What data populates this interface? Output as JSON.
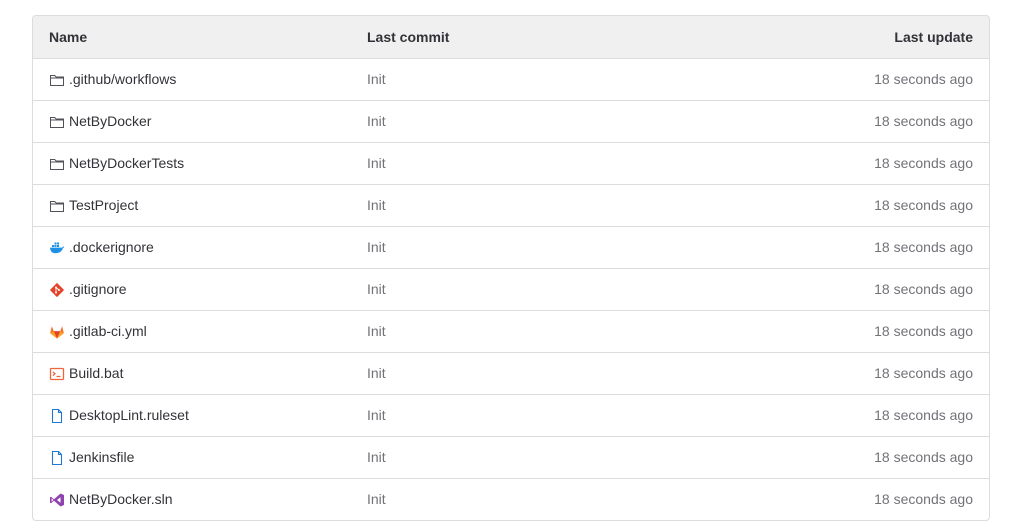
{
  "table": {
    "headers": {
      "name": "Name",
      "commit": "Last commit",
      "update": "Last update"
    },
    "rows": [
      {
        "name": ".github/workflows",
        "commit": "Init",
        "update": "18 seconds ago",
        "icon": "folder-icon"
      },
      {
        "name": "NetByDocker",
        "commit": "Init",
        "update": "18 seconds ago",
        "icon": "folder-icon"
      },
      {
        "name": "NetByDockerTests",
        "commit": "Init",
        "update": "18 seconds ago",
        "icon": "folder-icon"
      },
      {
        "name": "TestProject",
        "commit": "Init",
        "update": "18 seconds ago",
        "icon": "folder-icon"
      },
      {
        "name": ".dockerignore",
        "commit": "Init",
        "update": "18 seconds ago",
        "icon": "docker-icon"
      },
      {
        "name": ".gitignore",
        "commit": "Init",
        "update": "18 seconds ago",
        "icon": "git-icon"
      },
      {
        "name": ".gitlab-ci.yml",
        "commit": "Init",
        "update": "18 seconds ago",
        "icon": "gitlab-icon"
      },
      {
        "name": "Build.bat",
        "commit": "Init",
        "update": "18 seconds ago",
        "icon": "terminal-icon"
      },
      {
        "name": "DesktopLint.ruleset",
        "commit": "Init",
        "update": "18 seconds ago",
        "icon": "file-icon"
      },
      {
        "name": "Jenkinsfile",
        "commit": "Init",
        "update": "18 seconds ago",
        "icon": "file-icon"
      },
      {
        "name": "NetByDocker.sln",
        "commit": "Init",
        "update": "18 seconds ago",
        "icon": "visual-studio-icon"
      }
    ]
  },
  "colors": {
    "folder": "#535158",
    "docker": "#1d91e6",
    "git": "#e24329",
    "gitlab": "#fc6d26",
    "terminal": "#f0643c",
    "file": "#1f78d1",
    "visual_studio": "#8e44ad"
  }
}
